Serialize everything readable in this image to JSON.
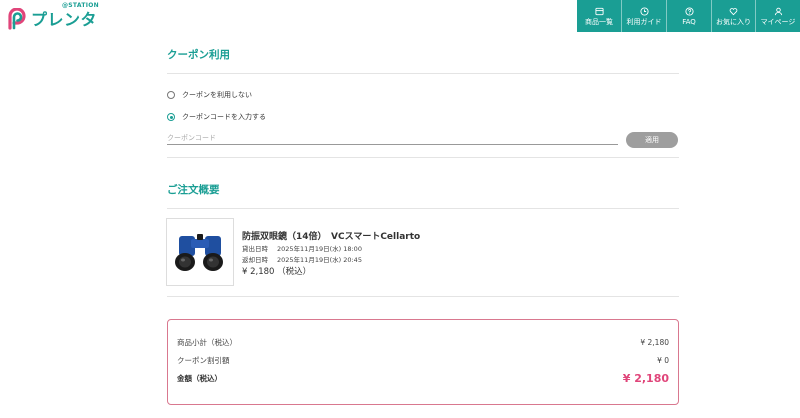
{
  "brand": {
    "name": "プレンタ",
    "sub": "@STATION",
    "accent": "#1a9e94",
    "logo_colors": [
      "#e0457a",
      "#1a9e94"
    ]
  },
  "nav": [
    {
      "icon": "list-icon",
      "label": "商品一覧"
    },
    {
      "icon": "clock-icon",
      "label": "利用ガイド"
    },
    {
      "icon": "question-icon",
      "label": "FAQ"
    },
    {
      "icon": "heart-icon",
      "label": "お気に入り"
    },
    {
      "icon": "user-icon",
      "label": "マイページ"
    }
  ],
  "coupon": {
    "title": "クーポン利用",
    "option_none": "クーポンを利用しない",
    "option_code": "クーポンコードを入力する",
    "selected": "option_code",
    "code_placeholder": "クーポンコード",
    "code_value": "",
    "apply_label": "適用"
  },
  "order": {
    "title": "ご注文概要",
    "product": {
      "image_icon": "binoculars-icon",
      "name": "防振双眼鏡（14倍）　VCスマートCellarto",
      "rent_label": "貸出日時",
      "rent_value": "2025年11月19日(水) 18:00",
      "return_label": "返却日時",
      "return_value": "2025年11月19日(水) 20:45",
      "price": "¥ 2,180 （税込）"
    }
  },
  "summary": {
    "border_color": "#d9788f",
    "total_color": "#e0457a",
    "subtotal_label": "商品小計（税込）",
    "subtotal_value": "¥ 2,180",
    "discount_label": "クーポン割引額",
    "discount_value": "¥ 0",
    "total_label": "金額（税込）",
    "total_value": "¥ 2,180"
  }
}
